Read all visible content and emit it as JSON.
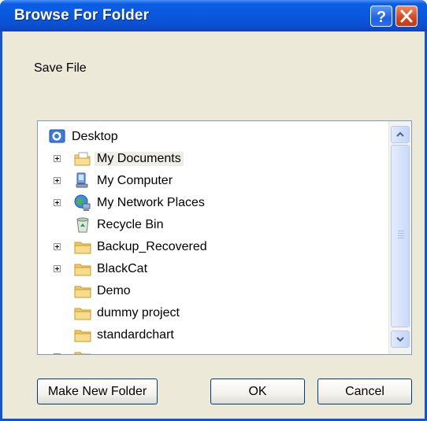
{
  "window": {
    "title": "Browse For Folder"
  },
  "dialog": {
    "description": "Save File"
  },
  "tree": {
    "items": [
      {
        "label": "Desktop",
        "icon": "desktop-icon",
        "expander": false
      },
      {
        "label": "My Documents",
        "icon": "my-documents-icon",
        "expander": true,
        "selected": true
      },
      {
        "label": "My Computer",
        "icon": "my-computer-icon",
        "expander": true
      },
      {
        "label": "My Network Places",
        "icon": "network-places-icon",
        "expander": true
      },
      {
        "label": "Recycle Bin",
        "icon": "recycle-bin-icon",
        "expander": false
      },
      {
        "label": "Backup_Recovered",
        "icon": "folder-icon",
        "expander": true
      },
      {
        "label": "BlackCat",
        "icon": "folder-icon",
        "expander": true
      },
      {
        "label": "Demo",
        "icon": "folder-icon",
        "expander": false
      },
      {
        "label": "dummy project",
        "icon": "folder-icon",
        "expander": false
      },
      {
        "label": "standardchart",
        "icon": "folder-icon",
        "expander": false
      }
    ]
  },
  "buttons": {
    "make_new_folder": "Make New Folder",
    "ok": "OK",
    "cancel": "Cancel"
  },
  "colors": {
    "titlebar": "#0a58dc",
    "dialog_bg": "#ece9d8",
    "close": "#d8431b"
  }
}
